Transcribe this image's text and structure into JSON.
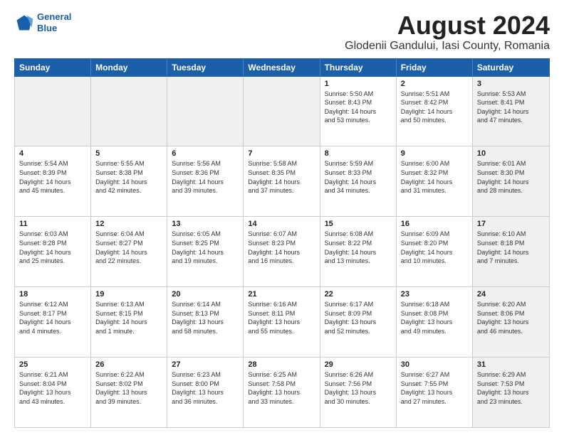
{
  "logo": {
    "line1": "General",
    "line2": "Blue"
  },
  "title": "August 2024",
  "location": "Glodenii Gandului, Iasi County, Romania",
  "header_days": [
    "Sunday",
    "Monday",
    "Tuesday",
    "Wednesday",
    "Thursday",
    "Friday",
    "Saturday"
  ],
  "rows": [
    [
      {
        "day": "",
        "info": "",
        "shaded": true
      },
      {
        "day": "",
        "info": "",
        "shaded": true
      },
      {
        "day": "",
        "info": "",
        "shaded": true
      },
      {
        "day": "",
        "info": "",
        "shaded": true
      },
      {
        "day": "1",
        "info": "Sunrise: 5:50 AM\nSunset: 8:43 PM\nDaylight: 14 hours\nand 53 minutes."
      },
      {
        "day": "2",
        "info": "Sunrise: 5:51 AM\nSunset: 8:42 PM\nDaylight: 14 hours\nand 50 minutes."
      },
      {
        "day": "3",
        "info": "Sunrise: 5:53 AM\nSunset: 8:41 PM\nDaylight: 14 hours\nand 47 minutes.",
        "shaded": true
      }
    ],
    [
      {
        "day": "4",
        "info": "Sunrise: 5:54 AM\nSunset: 8:39 PM\nDaylight: 14 hours\nand 45 minutes."
      },
      {
        "day": "5",
        "info": "Sunrise: 5:55 AM\nSunset: 8:38 PM\nDaylight: 14 hours\nand 42 minutes."
      },
      {
        "day": "6",
        "info": "Sunrise: 5:56 AM\nSunset: 8:36 PM\nDaylight: 14 hours\nand 39 minutes."
      },
      {
        "day": "7",
        "info": "Sunrise: 5:58 AM\nSunset: 8:35 PM\nDaylight: 14 hours\nand 37 minutes."
      },
      {
        "day": "8",
        "info": "Sunrise: 5:59 AM\nSunset: 8:33 PM\nDaylight: 14 hours\nand 34 minutes."
      },
      {
        "day": "9",
        "info": "Sunrise: 6:00 AM\nSunset: 8:32 PM\nDaylight: 14 hours\nand 31 minutes."
      },
      {
        "day": "10",
        "info": "Sunrise: 6:01 AM\nSunset: 8:30 PM\nDaylight: 14 hours\nand 28 minutes.",
        "shaded": true
      }
    ],
    [
      {
        "day": "11",
        "info": "Sunrise: 6:03 AM\nSunset: 8:28 PM\nDaylight: 14 hours\nand 25 minutes."
      },
      {
        "day": "12",
        "info": "Sunrise: 6:04 AM\nSunset: 8:27 PM\nDaylight: 14 hours\nand 22 minutes."
      },
      {
        "day": "13",
        "info": "Sunrise: 6:05 AM\nSunset: 8:25 PM\nDaylight: 14 hours\nand 19 minutes."
      },
      {
        "day": "14",
        "info": "Sunrise: 6:07 AM\nSunset: 8:23 PM\nDaylight: 14 hours\nand 16 minutes."
      },
      {
        "day": "15",
        "info": "Sunrise: 6:08 AM\nSunset: 8:22 PM\nDaylight: 14 hours\nand 13 minutes."
      },
      {
        "day": "16",
        "info": "Sunrise: 6:09 AM\nSunset: 8:20 PM\nDaylight: 14 hours\nand 10 minutes."
      },
      {
        "day": "17",
        "info": "Sunrise: 6:10 AM\nSunset: 8:18 PM\nDaylight: 14 hours\nand 7 minutes.",
        "shaded": true
      }
    ],
    [
      {
        "day": "18",
        "info": "Sunrise: 6:12 AM\nSunset: 8:17 PM\nDaylight: 14 hours\nand 4 minutes."
      },
      {
        "day": "19",
        "info": "Sunrise: 6:13 AM\nSunset: 8:15 PM\nDaylight: 14 hours\nand 1 minute."
      },
      {
        "day": "20",
        "info": "Sunrise: 6:14 AM\nSunset: 8:13 PM\nDaylight: 13 hours\nand 58 minutes."
      },
      {
        "day": "21",
        "info": "Sunrise: 6:16 AM\nSunset: 8:11 PM\nDaylight: 13 hours\nand 55 minutes."
      },
      {
        "day": "22",
        "info": "Sunrise: 6:17 AM\nSunset: 8:09 PM\nDaylight: 13 hours\nand 52 minutes."
      },
      {
        "day": "23",
        "info": "Sunrise: 6:18 AM\nSunset: 8:08 PM\nDaylight: 13 hours\nand 49 minutes."
      },
      {
        "day": "24",
        "info": "Sunrise: 6:20 AM\nSunset: 8:06 PM\nDaylight: 13 hours\nand 46 minutes.",
        "shaded": true
      }
    ],
    [
      {
        "day": "25",
        "info": "Sunrise: 6:21 AM\nSunset: 8:04 PM\nDaylight: 13 hours\nand 43 minutes."
      },
      {
        "day": "26",
        "info": "Sunrise: 6:22 AM\nSunset: 8:02 PM\nDaylight: 13 hours\nand 39 minutes."
      },
      {
        "day": "27",
        "info": "Sunrise: 6:23 AM\nSunset: 8:00 PM\nDaylight: 13 hours\nand 36 minutes."
      },
      {
        "day": "28",
        "info": "Sunrise: 6:25 AM\nSunset: 7:58 PM\nDaylight: 13 hours\nand 33 minutes."
      },
      {
        "day": "29",
        "info": "Sunrise: 6:26 AM\nSunset: 7:56 PM\nDaylight: 13 hours\nand 30 minutes."
      },
      {
        "day": "30",
        "info": "Sunrise: 6:27 AM\nSunset: 7:55 PM\nDaylight: 13 hours\nand 27 minutes."
      },
      {
        "day": "31",
        "info": "Sunrise: 6:29 AM\nSunset: 7:53 PM\nDaylight: 13 hours\nand 23 minutes.",
        "shaded": true
      }
    ]
  ]
}
